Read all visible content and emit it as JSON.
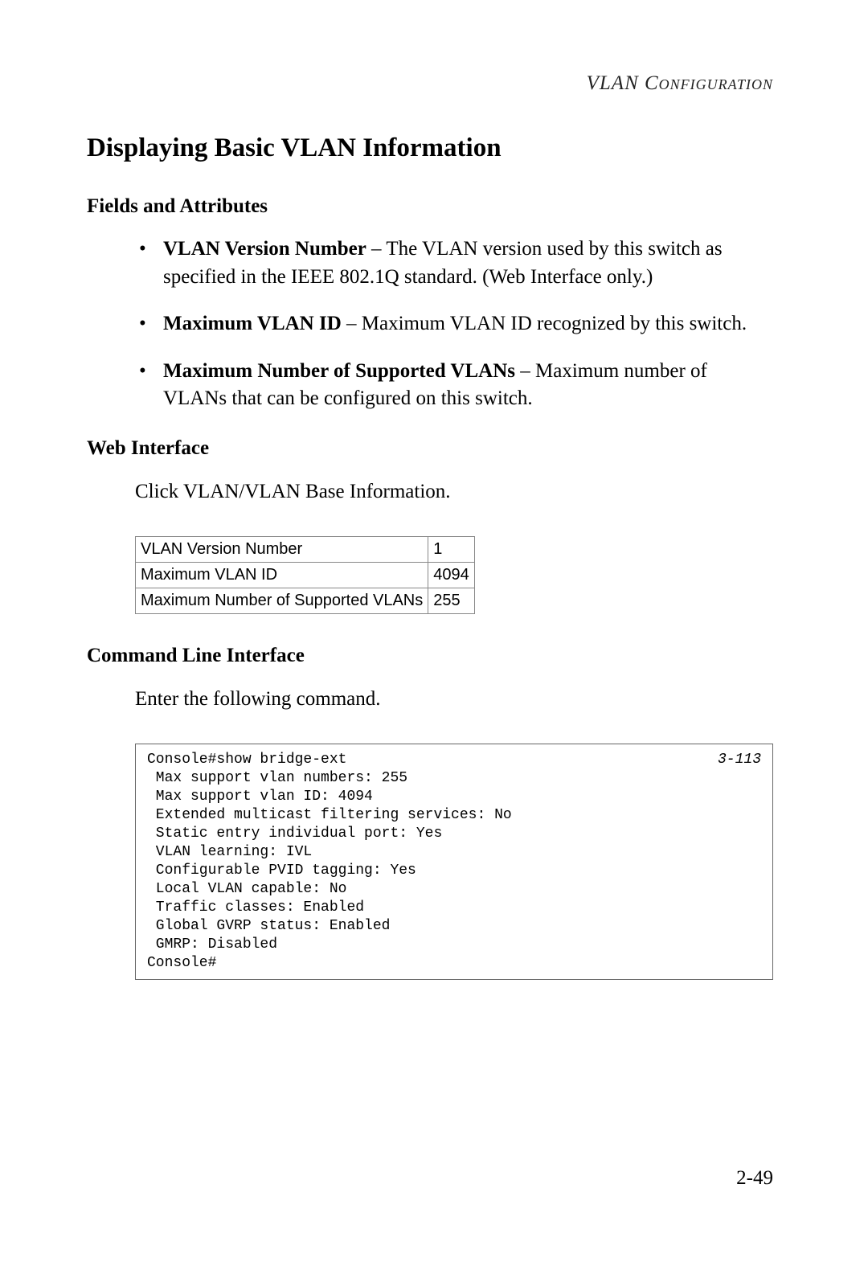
{
  "header": {
    "right": "VLAN Configuration"
  },
  "title": "Displaying Basic VLAN Information",
  "fields": {
    "heading": "Fields and Attributes",
    "items": [
      {
        "term": "VLAN Version Number",
        "dash": " – ",
        "desc": "The VLAN version used by this switch as specified in the IEEE 802.1Q standard. (Web Interface only.)"
      },
      {
        "term": "Maximum VLAN ID",
        "dash": " – ",
        "desc": "Maximum VLAN ID recognized by this switch."
      },
      {
        "term": "Maximum Number of Supported VLANs",
        "dash": " – ",
        "desc": "Maximum number of VLANs that can be configured on this switch."
      }
    ]
  },
  "web": {
    "heading": "Web Interface",
    "intro": "Click VLAN/VLAN Base Information.",
    "table": [
      {
        "label": "VLAN Version Number",
        "value": "1"
      },
      {
        "label": "Maximum VLAN ID",
        "value": "4094"
      },
      {
        "label": "Maximum Number of Supported VLANs",
        "value": "255"
      }
    ]
  },
  "cli": {
    "heading": "Command Line Interface",
    "intro": "Enter the following command.",
    "ref": "3-113",
    "lines": "Console#show bridge-ext\n Max support vlan numbers: 255\n Max support vlan ID: 4094\n Extended multicast filtering services: No\n Static entry individual port: Yes\n VLAN learning: IVL\n Configurable PVID tagging: Yes\n Local VLAN capable: No\n Traffic classes: Enabled\n Global GVRP status: Enabled\n GMRP: Disabled\nConsole#"
  },
  "pageNumber": "2-49"
}
